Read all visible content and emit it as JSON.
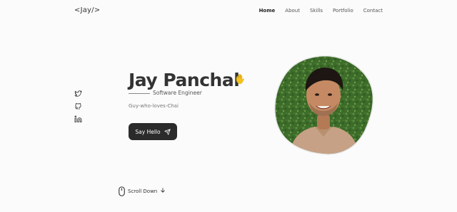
{
  "header": {
    "logo": "<Jay/>",
    "nav": [
      {
        "label": "Home",
        "active": true
      },
      {
        "label": "About",
        "active": false
      },
      {
        "label": "Skills",
        "active": false
      },
      {
        "label": "Portfolio",
        "active": false
      },
      {
        "label": "Contact",
        "active": false
      }
    ]
  },
  "socials": [
    {
      "icon": "twitter-icon"
    },
    {
      "icon": "github-icon"
    },
    {
      "icon": "linkedin-icon"
    }
  ],
  "hero": {
    "name": "Jay Panchal",
    "wave_icon": "waving-hand-icon",
    "subtitle": "Software Engineer",
    "description": "Guy-who-loves-Chai",
    "button_label": "Say Hello",
    "button_icon": "send-icon"
  },
  "scroll": {
    "label": "Scroll Down",
    "icons": [
      "mouse-icon",
      "arrow-down-icon"
    ]
  },
  "profile_image": {
    "background": "green hedge",
    "shirt_color": "#c7a185"
  },
  "colors": {
    "accent": "#2b2b2b",
    "background": "#fbfbfb",
    "wave": "#f5c21b"
  }
}
